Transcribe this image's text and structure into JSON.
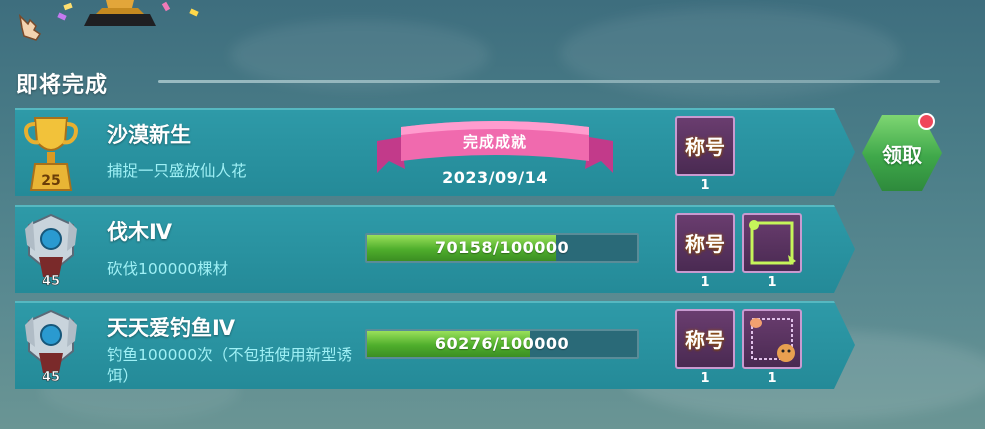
{
  "section": {
    "title": "即将完成"
  },
  "achievements": [
    {
      "title": "沙漠新生",
      "description": "捕捉一只盛放仙人花",
      "badge_level": "25",
      "status": "完成成就",
      "date": "2023/09/14",
      "rewards": [
        {
          "label": "称号",
          "count": "1"
        }
      ],
      "claim_label": "领取"
    },
    {
      "title": "伐木Ⅳ",
      "description": "砍伐100000棵材",
      "badge_level": "45",
      "progress_text": "70158/100000",
      "progress": {
        "current": 70158,
        "total": 100000
      },
      "rewards": [
        {
          "label": "称号",
          "count": "1"
        },
        {
          "label": "",
          "count": "1"
        }
      ]
    },
    {
      "title": "天天爱钓鱼Ⅳ",
      "description": "钓鱼100000次（不包括使用新型诱饵）",
      "badge_level": "45",
      "progress_text": "60276/100000",
      "progress": {
        "current": 60276,
        "total": 100000
      },
      "rewards": [
        {
          "label": "称号",
          "count": "1"
        },
        {
          "label": "",
          "count": "1"
        }
      ]
    }
  ],
  "icons": {
    "top_left": "pointing-hand-icon",
    "top_center": "trophy-base-icon",
    "row_badge_gold": "gold-trophy-icon",
    "row_badge_silver": "silver-emblem-icon",
    "reward_frame": "avatar-frame-icon"
  },
  "colors": {
    "row_bg": "#2a93a2",
    "description": "#9ff0f5",
    "progress_fill": "#5bb934",
    "claim_button": "#4fb854",
    "red_dot": "#f0475a",
    "reward_bg": "#5a3360"
  }
}
